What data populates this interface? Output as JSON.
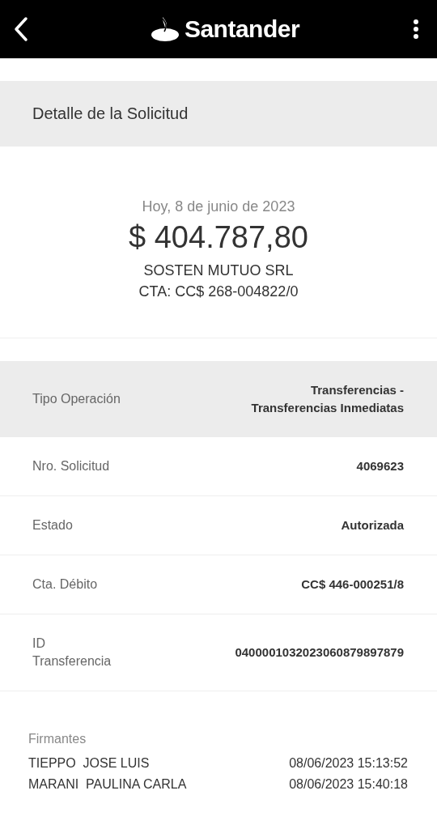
{
  "top_bar": {
    "brand": "Santander"
  },
  "section_title": "Detalle de la Solicitud",
  "summary": {
    "date": "Hoy, 8 de junio de 2023",
    "amount": "$ 404.787,80",
    "name": "SOSTEN MUTUO SRL",
    "account": "CTA: CC$ 268-004822/0"
  },
  "details": [
    {
      "label": "Tipo Operación",
      "value": "Transferencias - Transferencias Inmediatas",
      "highlighted": true
    },
    {
      "label": "Nro. Solicitud",
      "value": "4069623",
      "highlighted": false
    },
    {
      "label": "Estado",
      "value": "Autorizada",
      "highlighted": false
    },
    {
      "label": "Cta. Débito",
      "value": "CC$ 446-000251/8",
      "highlighted": false
    },
    {
      "label": "ID Transferencia",
      "value": "0400001032023060879897879",
      "highlighted": false
    }
  ],
  "signers": {
    "title": "Firmantes",
    "rows": [
      {
        "name": "TIEPPO  JOSE LUIS",
        "time": "08/06/2023 15:13:52"
      },
      {
        "name": "MARANI  PAULINA CARLA",
        "time": "08/06/2023 15:40:18"
      }
    ]
  }
}
